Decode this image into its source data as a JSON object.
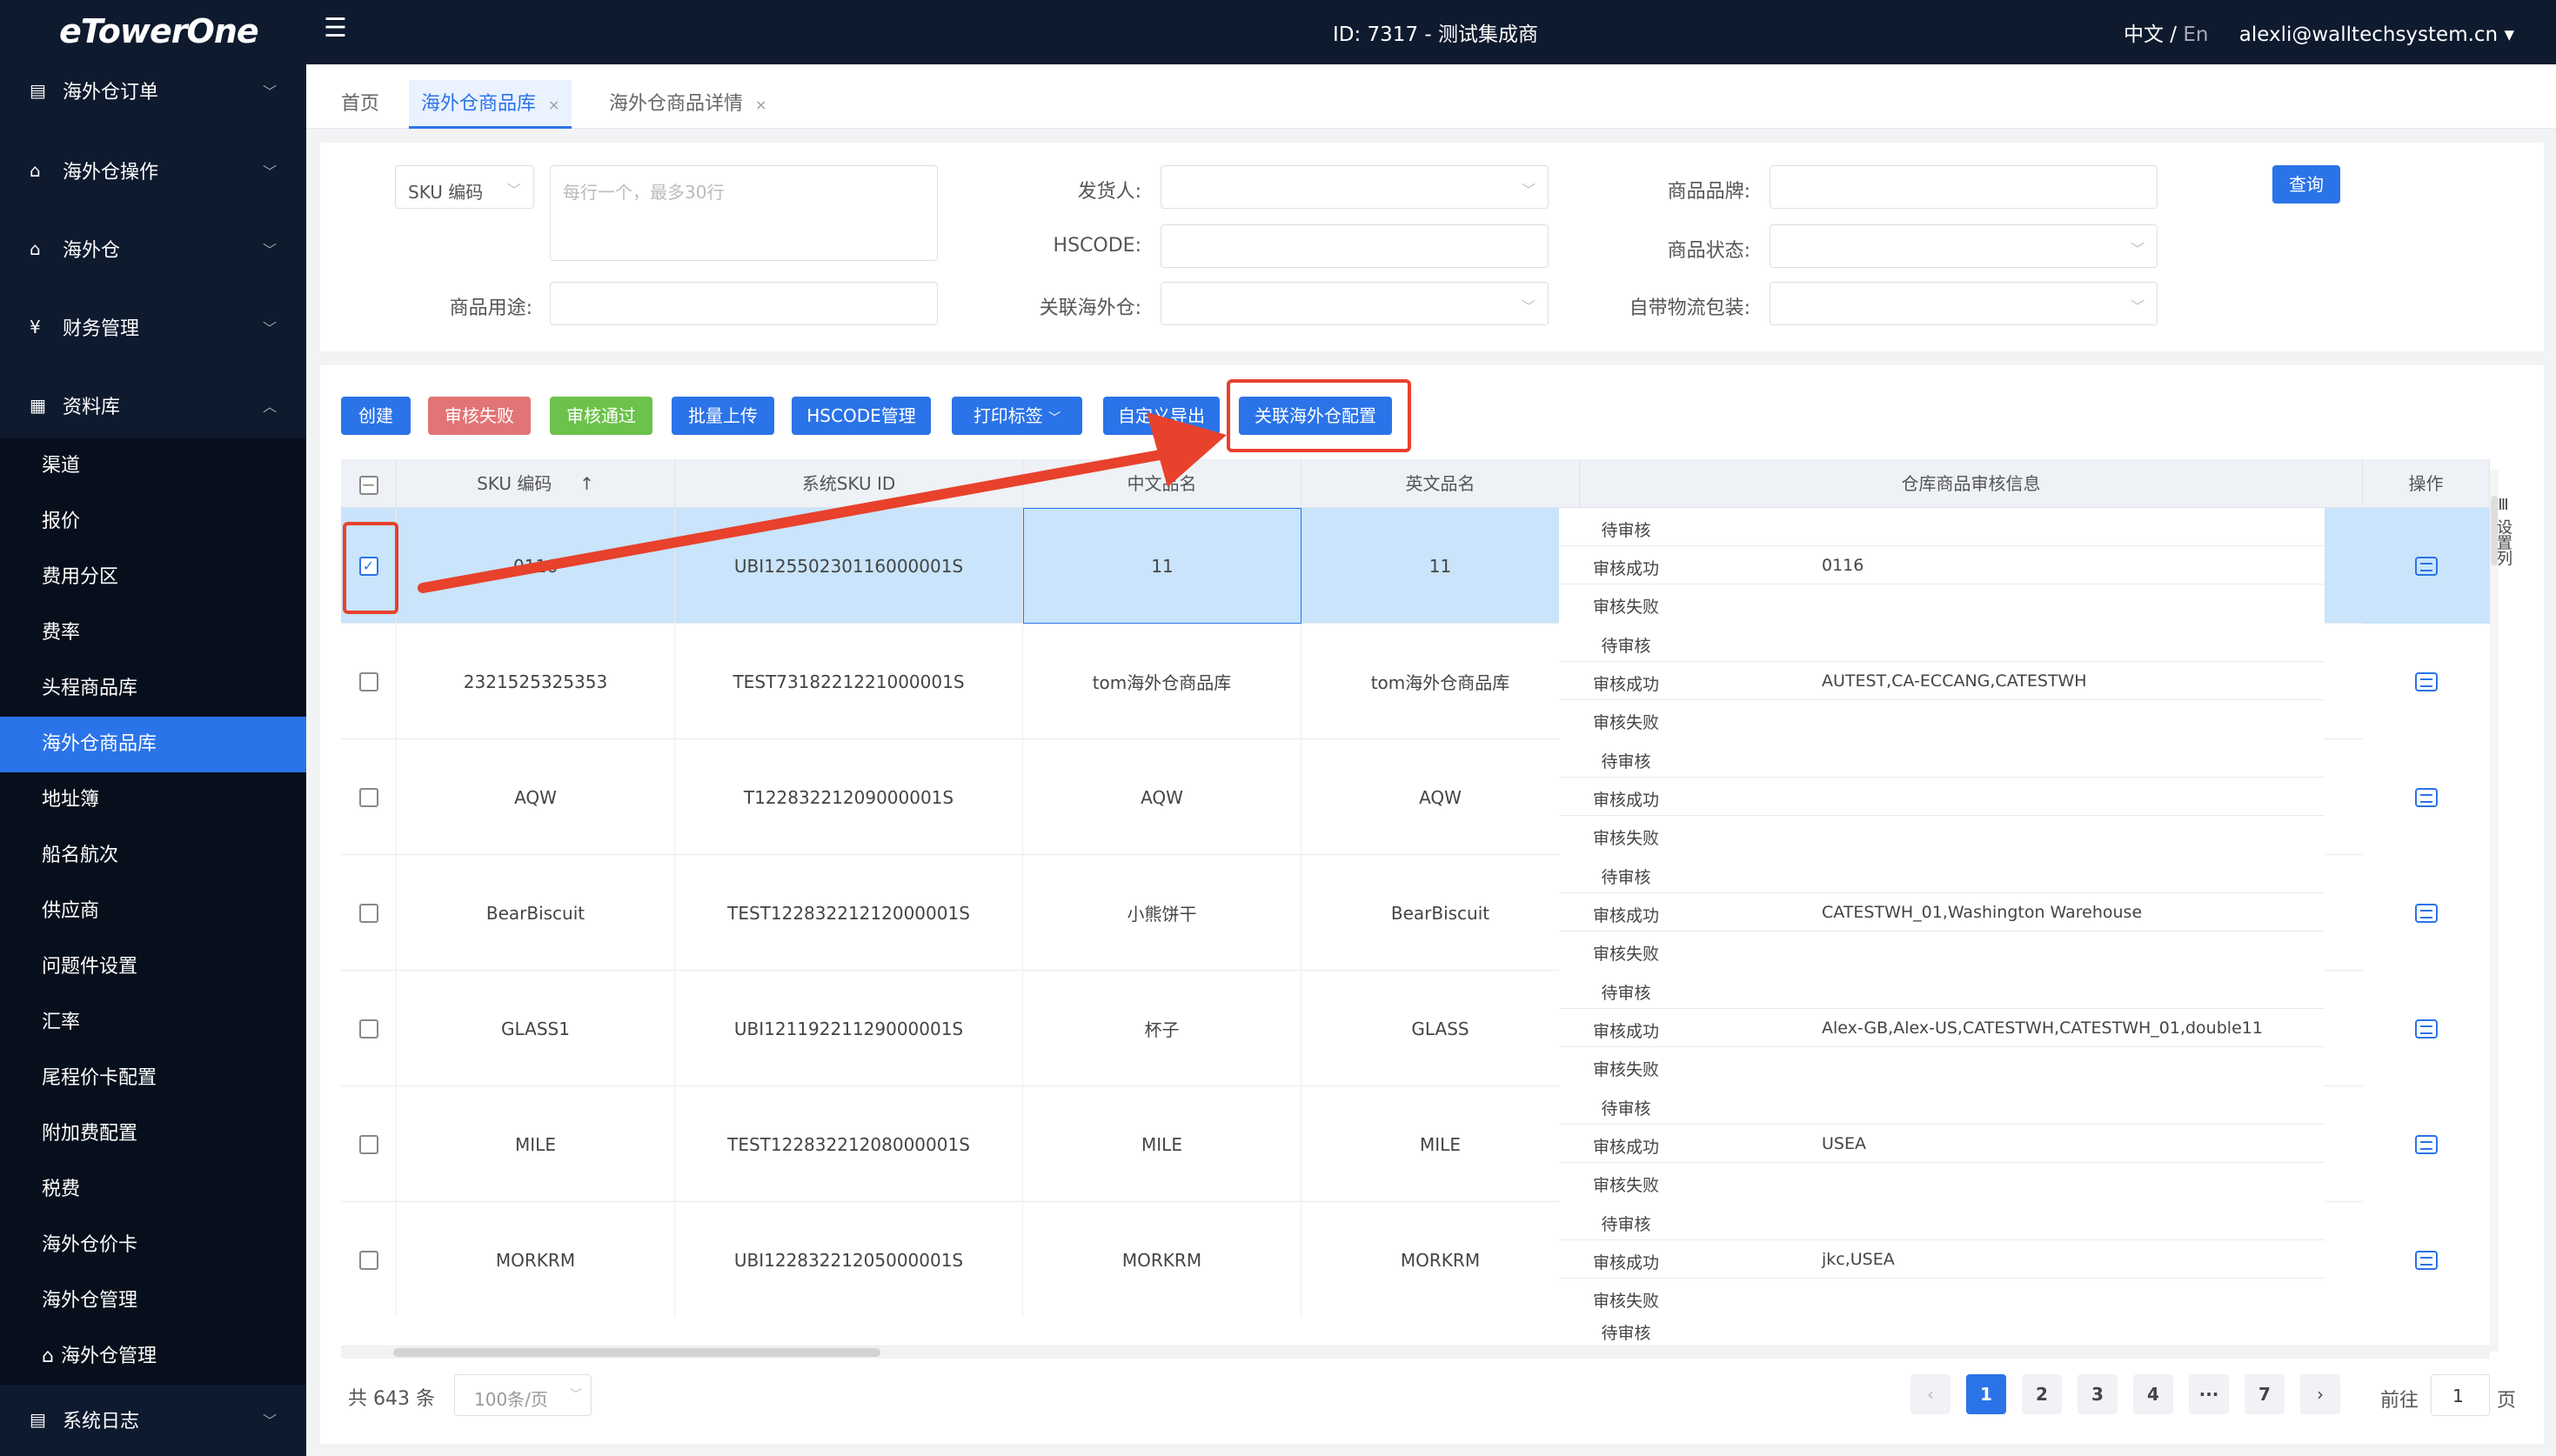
{
  "topbar": {
    "logo": "eTowerOne",
    "center_title": "ID: 7317 - 测试集成商",
    "lang_zh": "中文",
    "lang_sep": " / ",
    "lang_en": "En",
    "user_email": "alexli@walltechsystem.cn ▾"
  },
  "sidebar": {
    "groups": [
      {
        "label": "海外仓订单"
      },
      {
        "label": "海外仓操作"
      },
      {
        "label": "海外仓"
      },
      {
        "label": "财务管理"
      },
      {
        "label": "资料库"
      },
      {
        "label": "系统日志"
      }
    ],
    "sub_items": [
      "渠道",
      "报价",
      "费用分区",
      "费率",
      "头程商品库",
      "海外仓商品库",
      "地址簿",
      "船名航次",
      "供应商",
      "问题件设置",
      "汇率",
      "尾程价卡配置",
      "附加费配置",
      "税费",
      "海外仓价卡",
      "海外仓管理",
      "海外仓管理"
    ]
  },
  "tabs": [
    {
      "label": "首页"
    },
    {
      "label": "海外仓商品库",
      "close": "×"
    },
    {
      "label": "海外仓商品详情",
      "close": "×"
    }
  ],
  "filters": {
    "sku_select": "SKU 编码",
    "sku_placeholder": "每行一个，最多30行",
    "shipper": "发货人:",
    "brand": "商品品牌:",
    "hscode": "HSCODE:",
    "status": "商品状态:",
    "usage": "商品用途:",
    "warehouse": "关联海外仓:",
    "packaging": "自带物流包装:",
    "query": "查询"
  },
  "actions": {
    "create": "创建",
    "fail": "审核失败",
    "pass": "审核通过",
    "upload": "批量上传",
    "hscode": "HSCODE管理",
    "print": "打印标签",
    "export": "自定义导出",
    "link": "关联海外仓配置"
  },
  "table": {
    "headers": {
      "sku": "SKU 编码",
      "sort": "↑",
      "sys_sku": "系统SKU ID",
      "cn_name": "中文品名",
      "en_name": "英文品名",
      "audit": "仓库商品审核信息",
      "op": "操作"
    },
    "audit_labels": [
      "待审核",
      "审核成功",
      "审核失败"
    ],
    "rows": [
      {
        "sku": "0116",
        "sys_sku": "UBI12550230116000001S",
        "cn": "11",
        "en": "11",
        "success": "0116",
        "checked": true
      },
      {
        "sku": "2321525325353",
        "sys_sku": "TEST7318221221000001S",
        "cn": "tom海外仓商品库",
        "en": "tom海外仓商品库",
        "success": "AUTEST,CA-ECCANG,CATESTWH",
        "checked": false
      },
      {
        "sku": "AQW",
        "sys_sku": "T12283221209000001S",
        "cn": "AQW",
        "en": "AQW",
        "success": "",
        "checked": false
      },
      {
        "sku": "BearBiscuit",
        "sys_sku": "TEST12283221212000001S",
        "cn": "小熊饼干",
        "en": "BearBiscuit",
        "success": "CATESTWH_01,Washington Warehouse",
        "checked": false
      },
      {
        "sku": "GLASS1",
        "sys_sku": "UBI12119221129000001S",
        "cn": "杯子",
        "en": "GLASS",
        "success": "Alex-GB,Alex-US,CATESTWH,CATESTWH_01,double11",
        "checked": false
      },
      {
        "sku": "MILE",
        "sys_sku": "TEST12283221208000001S",
        "cn": "MILE",
        "en": "MILE",
        "success": "USEA",
        "checked": false
      },
      {
        "sku": "MORKRM",
        "sys_sku": "UBI12283221205000001S",
        "cn": "MORKRM",
        "en": "MORKRM",
        "success": "jkc,USEA",
        "checked": false
      }
    ],
    "partial_row_label": "待审核",
    "settings": "设置列"
  },
  "pagination": {
    "total": "共 643 条",
    "page_size": "100条/页",
    "prev": "‹",
    "pages": [
      "1",
      "2",
      "3",
      "4",
      "···",
      "7"
    ],
    "next": "›",
    "goto_prefix": "前往",
    "goto_value": "1",
    "goto_suffix": "页"
  },
  "colors": {
    "primary": "#2b73e8",
    "sidebar": "#0e1a2e",
    "annotation_red": "#e8412c"
  }
}
